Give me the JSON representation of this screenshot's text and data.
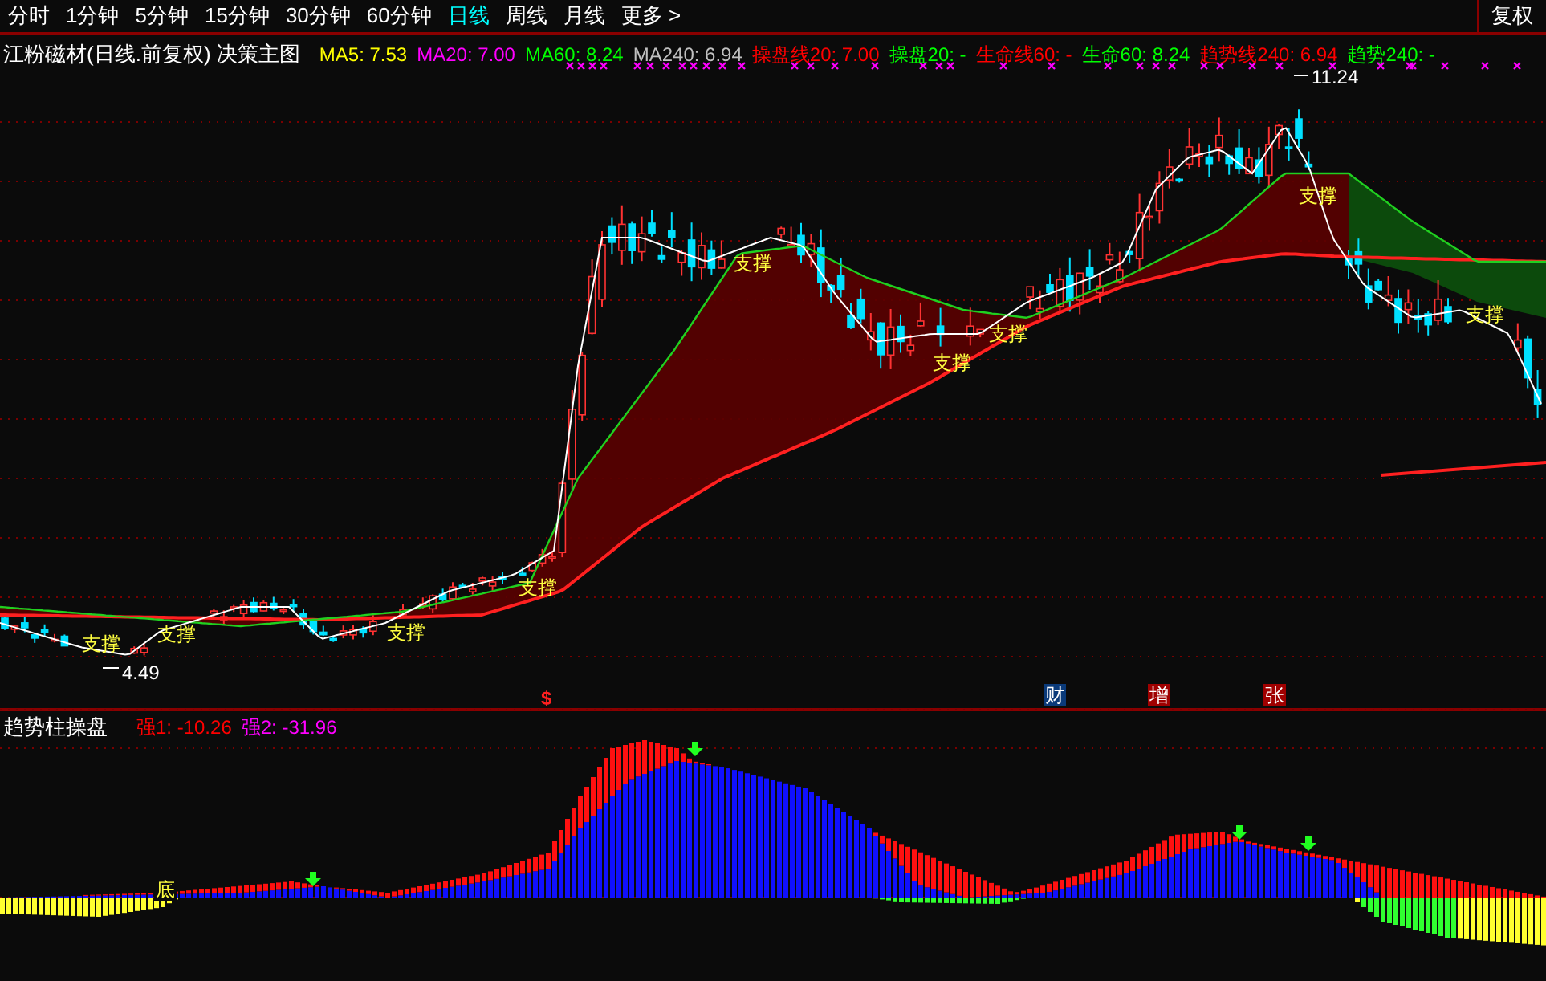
{
  "menu": {
    "tabs": [
      {
        "label": "分时",
        "selected": false
      },
      {
        "label": "1分钟",
        "selected": false
      },
      {
        "label": "5分钟",
        "selected": false
      },
      {
        "label": "15分钟",
        "selected": false
      },
      {
        "label": "30分钟",
        "selected": false
      },
      {
        "label": "60分钟",
        "selected": false
      },
      {
        "label": "日线",
        "selected": true
      },
      {
        "label": "周线",
        "selected": false
      },
      {
        "label": "月线",
        "selected": false
      }
    ],
    "more": "更多 >",
    "adjust_button": "复权"
  },
  "main_chart": {
    "title": "江粉磁材(日线.前复权) 决策主图",
    "legend": [
      {
        "label": "MA5: 7.53",
        "color": "#ffff00"
      },
      {
        "label": "MA20: 7.00",
        "color": "#ff00ff"
      },
      {
        "label": "MA60: 8.24",
        "color": "#00ff00"
      },
      {
        "label": "MA240: 6.94",
        "color": "#c0c0c0"
      },
      {
        "label": "操盘线20: 7.00",
        "color": "#ff0000"
      },
      {
        "label": "操盘20: -",
        "color": "#00ff00"
      },
      {
        "label": "生命线60: -",
        "color": "#ff0000"
      },
      {
        "label": "生命60: 8.24",
        "color": "#00ff00"
      },
      {
        "label": "趋势线240: 6.94",
        "color": "#ff0000"
      },
      {
        "label": "趋势240: -",
        "color": "#00ff00"
      }
    ],
    "price_labels": [
      "4.49",
      "11.24"
    ],
    "support_labels": [
      "支撑",
      "支撑",
      "支撑",
      "支撑",
      "支撑",
      "支撑",
      "支撑",
      "支撑",
      "支撑"
    ],
    "markers": [
      {
        "kind": "dollar",
        "text": "$"
      },
      {
        "kind": "finance",
        "text": "财"
      },
      {
        "kind": "increase",
        "text": "增"
      },
      {
        "kind": "rise",
        "text": "张"
      }
    ]
  },
  "indicator": {
    "title": "趋势柱操盘",
    "legend": [
      {
        "label": "强1: -10.26",
        "color": "#ff0000"
      },
      {
        "label": "强2: -31.96",
        "color": "#ff00ff"
      }
    ],
    "bottom_label": "底"
  }
}
